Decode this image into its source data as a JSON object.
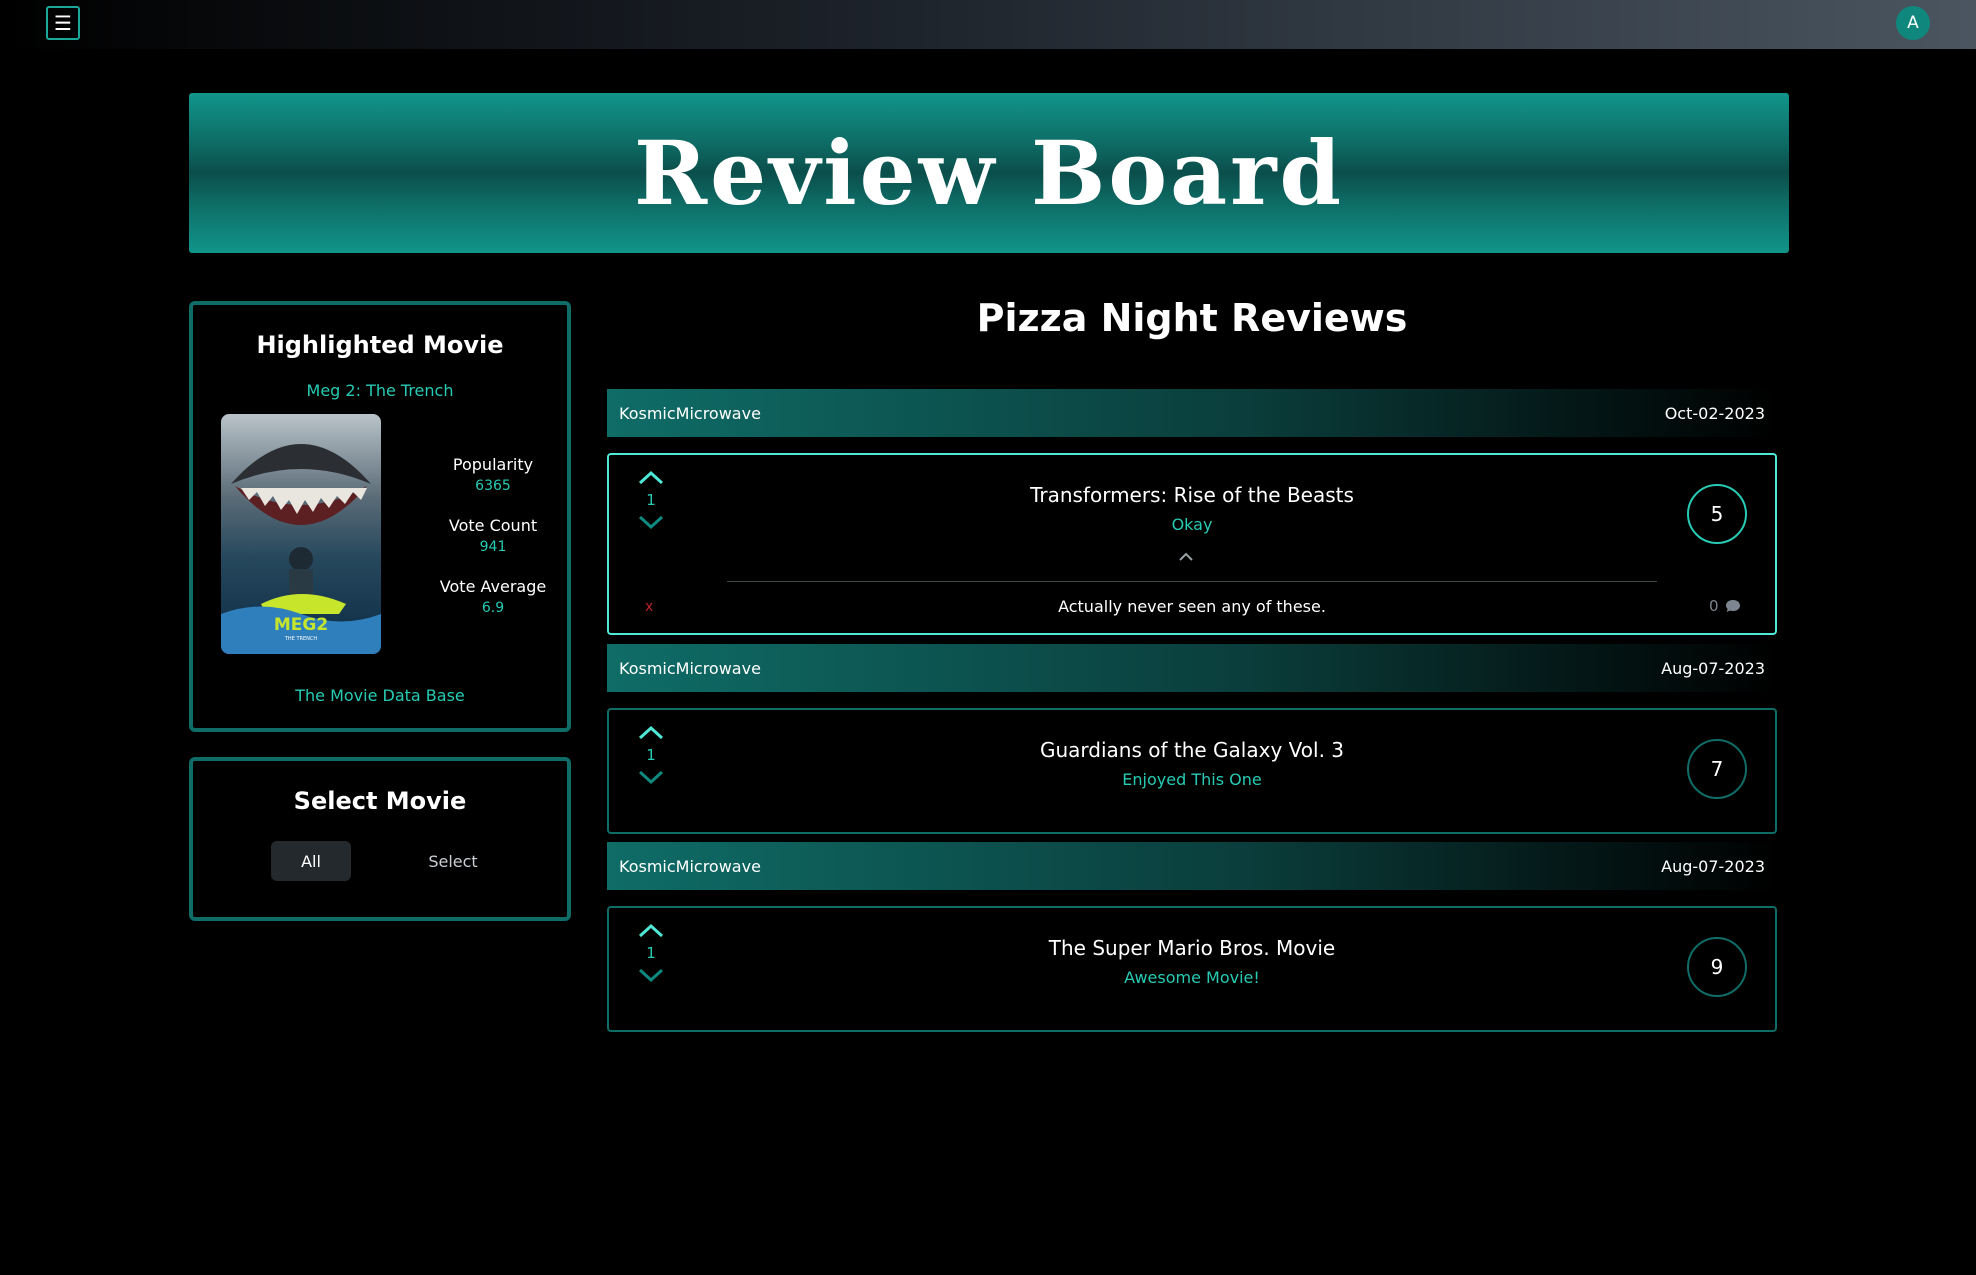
{
  "topbar": {
    "menu_icon": "☰",
    "avatar_letter": "A"
  },
  "banner": {
    "title": "Review Board"
  },
  "highlighted": {
    "heading": "Highlighted Movie",
    "movie_title": "Meg 2: The Trench",
    "poster_text": "MEG2",
    "poster_subtext": "THE TRENCH",
    "stats": [
      {
        "label": "Popularity",
        "value": "6365"
      },
      {
        "label": "Vote Count",
        "value": "941"
      },
      {
        "label": "Vote Average",
        "value": "6.9"
      }
    ],
    "source_link": "The Movie Data Base"
  },
  "select_movie": {
    "heading": "Select Movie",
    "all_label": "All",
    "select_label": "Select"
  },
  "reviews_title": "Pizza Night Reviews",
  "reviews": [
    {
      "author": "KosmicMicrowave",
      "date": "Oct-02-2023",
      "votes": "1",
      "movie": "Transformers: Rise of the Beasts",
      "tagline": "Okay",
      "score": "5",
      "comment": "Actually never seen any of these.",
      "delete_label": "x",
      "comment_count": "0"
    },
    {
      "author": "KosmicMicrowave",
      "date": "Aug-07-2023",
      "votes": "1",
      "movie": "Guardians of the Galaxy Vol. 3",
      "tagline": "Enjoyed This One",
      "score": "7"
    },
    {
      "author": "KosmicMicrowave",
      "date": "Aug-07-2023",
      "votes": "1",
      "movie": "The Super Mario Bros. Movie",
      "tagline": "Awesome Movie!",
      "score": "9"
    }
  ],
  "colors": {
    "accent": "#27cbb4",
    "border": "#0f6c67",
    "active_border": "#4fe8d6",
    "delete": "#c0222a"
  }
}
